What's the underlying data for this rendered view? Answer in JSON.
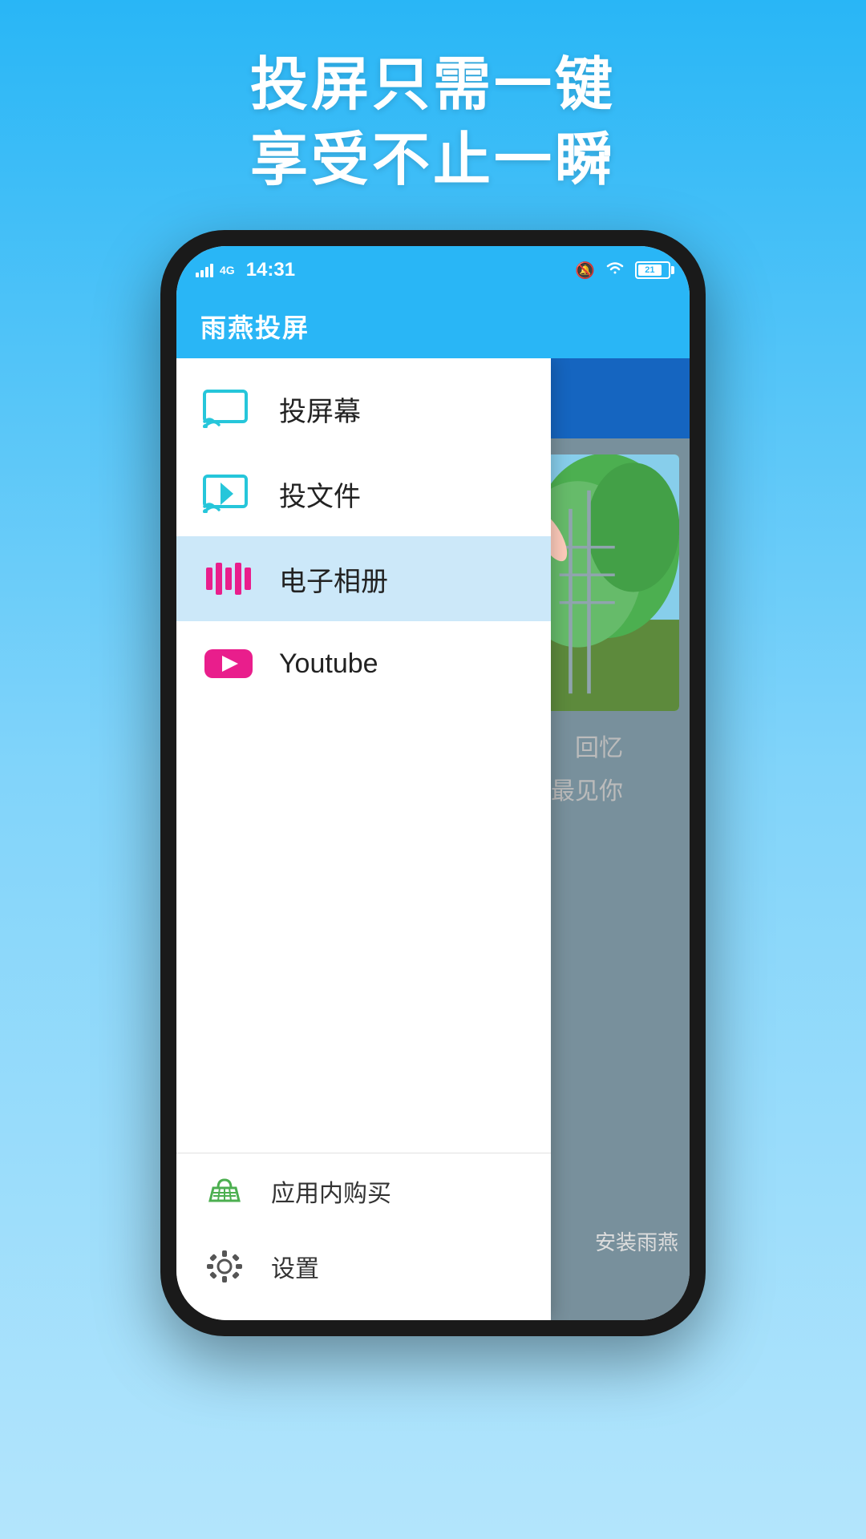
{
  "background": {
    "gradient_top": "#29b6f6",
    "gradient_bottom": "#b3e5fc"
  },
  "top_text": {
    "line1": "投屏只需一键",
    "line2": "享受不止一瞬"
  },
  "status_bar": {
    "time": "14:31",
    "lte": "4G",
    "battery_level": "21"
  },
  "app_bar": {
    "title": "雨燕投屏"
  },
  "menu": {
    "items": [
      {
        "id": "cast-screen",
        "label": "投屏幕",
        "icon": "cast-screen-icon",
        "active": false
      },
      {
        "id": "cast-file",
        "label": "投文件",
        "icon": "cast-file-icon",
        "active": false
      },
      {
        "id": "slideshow",
        "label": "电子相册",
        "icon": "slideshow-icon",
        "active": true
      },
      {
        "id": "youtube",
        "label": "Youtube",
        "icon": "youtube-icon",
        "active": false
      }
    ],
    "bottom_items": [
      {
        "id": "purchase",
        "label": "应用内购买",
        "icon": "shop-icon"
      },
      {
        "id": "settings",
        "label": "设置",
        "icon": "settings-icon"
      }
    ]
  },
  "main_content": {
    "memory_text_line1": "回忆",
    "memory_text_line2": "最见你",
    "install_text": "安装雨燕"
  }
}
